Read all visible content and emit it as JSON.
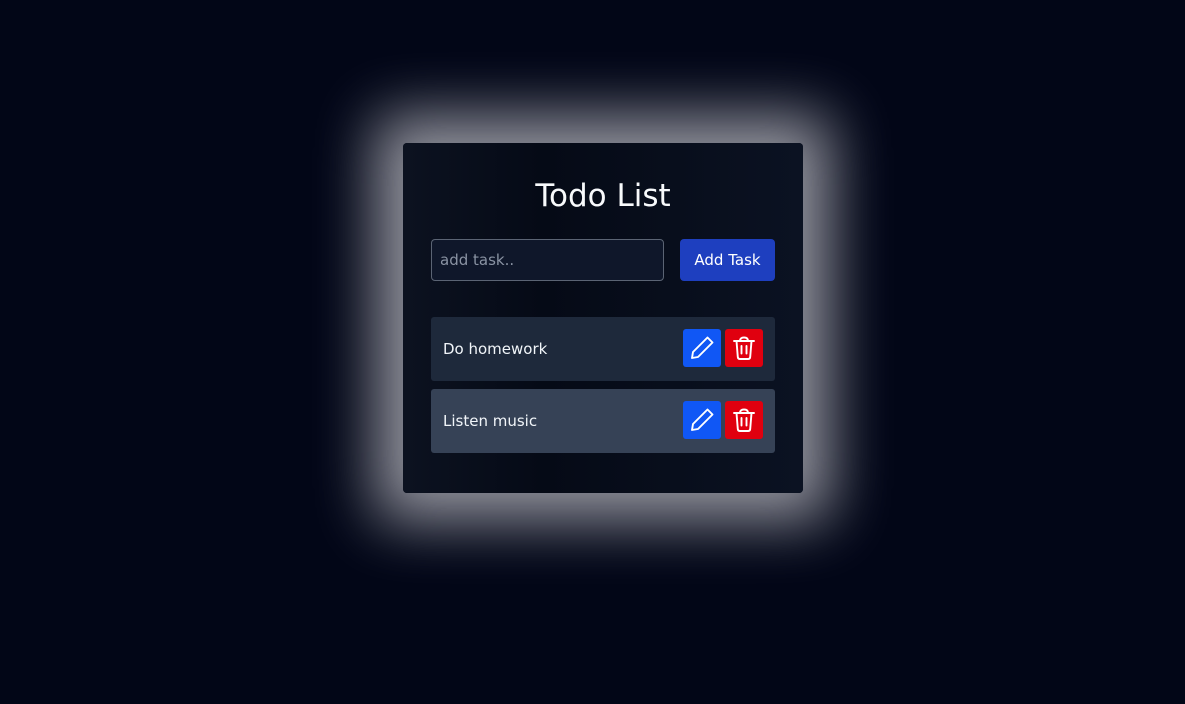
{
  "app": {
    "title": "Todo List"
  },
  "form": {
    "input_placeholder": "add task..",
    "input_value": "",
    "add_button_label": "Add Task"
  },
  "tasks": [
    {
      "text": "Do homework",
      "edit_icon": "pencil-icon",
      "delete_icon": "trash-icon"
    },
    {
      "text": "Listen music",
      "edit_icon": "pencil-icon",
      "delete_icon": "trash-icon"
    }
  ],
  "colors": {
    "page_background": "#020617",
    "glow": "#ebebf0",
    "primary_button": "#1e3fbf",
    "edit_button": "#1057f5",
    "delete_button": "#e0000f",
    "task_row_1": "#1e293b",
    "task_row_2": "#364256"
  }
}
